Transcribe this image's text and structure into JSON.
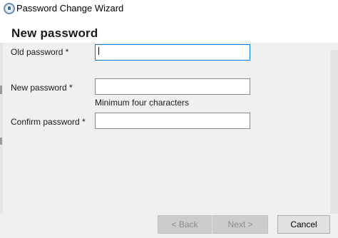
{
  "window": {
    "title": "Password Change Wizard",
    "icon": "wizard-icon"
  },
  "page": {
    "heading": "New password"
  },
  "form": {
    "old_password": {
      "label": "Old password *",
      "value": "",
      "focused": true
    },
    "new_password": {
      "label": "New password *",
      "value": "",
      "hint": "Minimum four characters"
    },
    "confirm_password": {
      "label": "Confirm password *",
      "value": ""
    }
  },
  "buttons": {
    "back": {
      "label": "< Back",
      "enabled": false
    },
    "next": {
      "label": "Next >",
      "enabled": false
    },
    "cancel": {
      "label": "Cancel",
      "enabled": true
    }
  },
  "colors": {
    "content_bg": "#f0f0f0",
    "focus_border": "#0078d7",
    "disabled_text": "#8c8c8c"
  }
}
